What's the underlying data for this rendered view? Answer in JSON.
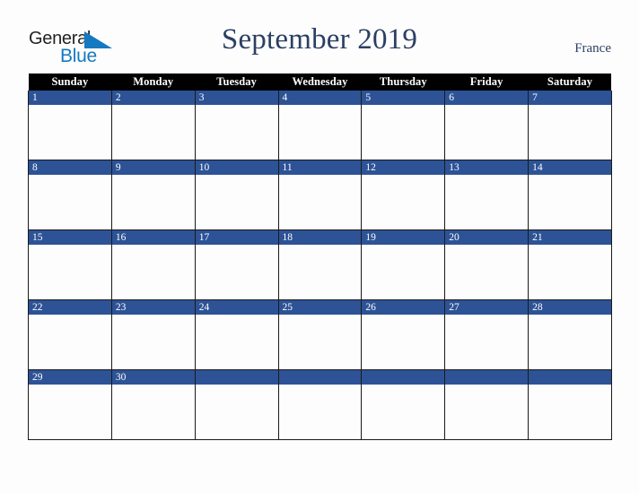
{
  "logo": {
    "word_primary": "General",
    "word_secondary": "Blue",
    "triangle_color": "#1579c1",
    "primary_color": "#232323",
    "secondary_color": "#1579c1"
  },
  "header": {
    "title": "September 2019",
    "region": "France",
    "title_color": "#2b3f63"
  },
  "calendar": {
    "weekday_headers": [
      "Sunday",
      "Monday",
      "Tuesday",
      "Wednesday",
      "Thursday",
      "Friday",
      "Saturday"
    ],
    "header_bg": "#000000",
    "header_fg": "#ffffff",
    "day_bar_bg": "#2d5396",
    "day_bar_fg": "#ffffff",
    "cell_bg": "#fdfdfd",
    "grid_line_color": "#1a1a1a",
    "weeks": [
      {
        "days": [
          "1",
          "2",
          "3",
          "4",
          "5",
          "6",
          "7"
        ]
      },
      {
        "days": [
          "8",
          "9",
          "10",
          "11",
          "12",
          "13",
          "14"
        ]
      },
      {
        "days": [
          "15",
          "16",
          "17",
          "18",
          "19",
          "20",
          "21"
        ]
      },
      {
        "days": [
          "22",
          "23",
          "24",
          "25",
          "26",
          "27",
          "28"
        ]
      },
      {
        "days": [
          "29",
          "30",
          "",
          "",
          "",
          "",
          ""
        ]
      }
    ]
  }
}
